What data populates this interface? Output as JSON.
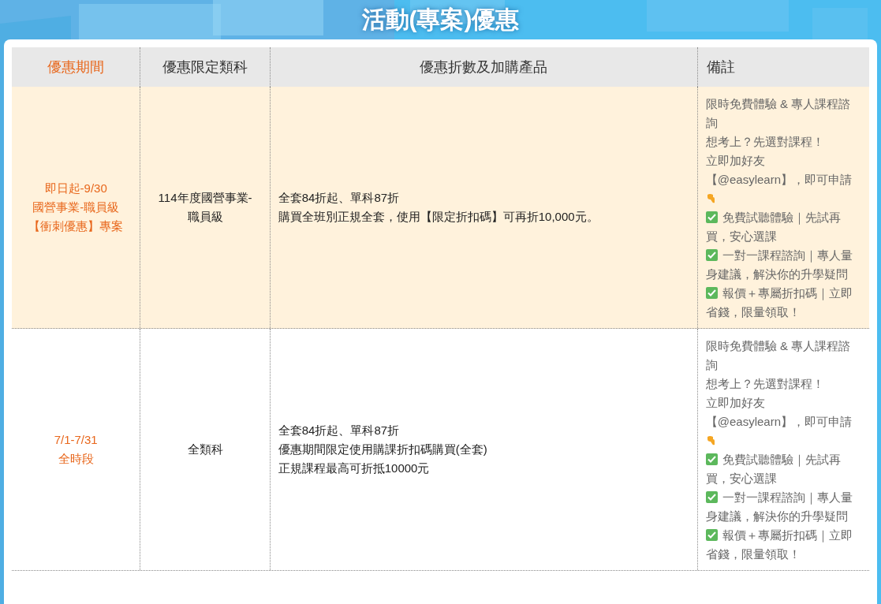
{
  "title": "活動(專案)優惠",
  "columns": [
    {
      "label": "優惠期間",
      "highlight": true
    },
    {
      "label": "優惠限定類科",
      "highlight": false
    },
    {
      "label": "優惠折數及加購產品",
      "highlight": false
    },
    {
      "label": "備註",
      "highlight": false
    }
  ],
  "rows": [
    {
      "highlight": true,
      "period": [
        "即日起-9/30",
        "國營事業-職員級",
        "【衝刺優惠】專案"
      ],
      "subject": [
        "114年度國營事業-",
        "職員級"
      ],
      "offer": [
        "全套84折起、單科87折",
        "購買全班別正規全套，使用【限定折扣碼】可再折10,000元。"
      ],
      "notes": [
        {
          "kind": "text",
          "text": "限時免費體驗 & 專人課程諮詢"
        },
        {
          "kind": "text",
          "text": "想考上？先選對課程！"
        },
        {
          "kind": "text",
          "text": "立即加好友"
        },
        {
          "kind": "text",
          "text": "【@easylearn】，即可申請"
        },
        {
          "kind": "pointer"
        },
        {
          "kind": "check",
          "text": "免費試聽體驗｜先試再買，安心選課"
        },
        {
          "kind": "check",
          "text": "一對一課程諮詢｜專人量身建議，解決你的升學疑問"
        },
        {
          "kind": "check",
          "text": "報價＋專屬折扣碼｜立即省錢，限量領取！"
        }
      ]
    },
    {
      "highlight": false,
      "period": [
        "7/1-7/31",
        "全時段"
      ],
      "subject": [
        "全類科"
      ],
      "offer": [
        "全套84折起、單科87折",
        "優惠期間限定使用購課折扣碼購買(全套)",
        "正規課程最高可折抵10000元"
      ],
      "notes": [
        {
          "kind": "text",
          "text": "限時免費體驗 & 專人課程諮詢"
        },
        {
          "kind": "text",
          "text": "想考上？先選對課程！"
        },
        {
          "kind": "text",
          "text": "立即加好友"
        },
        {
          "kind": "text",
          "text": "【@easylearn】，即可申請"
        },
        {
          "kind": "pointer"
        },
        {
          "kind": "check",
          "text": "免費試聽體驗｜先試再買，安心選課"
        },
        {
          "kind": "check",
          "text": "一對一課程諮詢｜專人量身建議，解決你的升學疑問"
        },
        {
          "kind": "check",
          "text": "報價＋專屬折扣碼｜立即省錢，限量領取！"
        }
      ]
    }
  ]
}
